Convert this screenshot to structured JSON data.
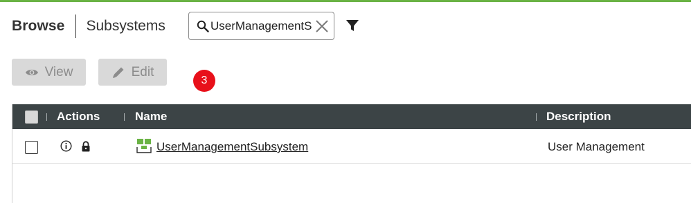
{
  "header": {
    "title": "Browse",
    "subtitle": "Subsystems"
  },
  "search": {
    "value": "UserManagementSubsystem",
    "placeholder": ""
  },
  "icons": {
    "search": "search-icon",
    "clear": "close-icon",
    "filter": "filter-icon",
    "view": "eye-icon",
    "edit": "pencil-icon",
    "info": "info-icon",
    "lock": "lock-icon",
    "app": "app-grid-icon"
  },
  "toolbar": {
    "view_label": "View",
    "edit_label": "Edit"
  },
  "badge": {
    "count": "3"
  },
  "table": {
    "headers": {
      "actions": "Actions",
      "name": "Name",
      "description": "Description"
    },
    "rows": [
      {
        "name": "UserManagementSubsystem",
        "description": "User Management"
      }
    ]
  },
  "colors": {
    "accent": "#6ab344",
    "header_bg": "#3c4446",
    "badge": "#e8101a",
    "app_icon": "#6ab344"
  }
}
